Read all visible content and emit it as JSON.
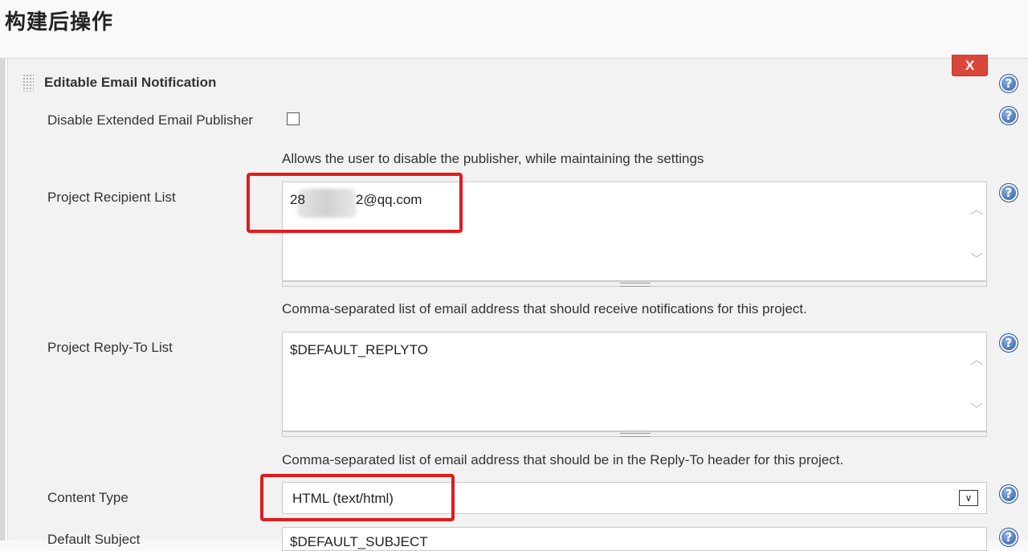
{
  "section": {
    "title": "构建后操作"
  },
  "panel": {
    "title": "Editable Email Notification",
    "delete_label": "X"
  },
  "help_label": "?",
  "disable_publisher": {
    "label": "Disable Extended Email Publisher",
    "checked": false,
    "description": "Allows the user to disable the publisher, while maintaining the settings"
  },
  "recipient_list": {
    "label": "Project Recipient List",
    "value_prefix": "28",
    "value_suffix": "2@qq.com",
    "description": "Comma-separated list of email address that should receive notifications for this project."
  },
  "reply_to_list": {
    "label": "Project Reply-To List",
    "value": "$DEFAULT_REPLYTO",
    "description": "Comma-separated list of email address that should be in the Reply-To header for this project."
  },
  "content_type": {
    "label": "Content Type",
    "value": "HTML (text/html)"
  },
  "default_subject": {
    "label": "Default Subject",
    "value": "$DEFAULT_SUBJECT"
  },
  "colors": {
    "highlight": "#e21b1b",
    "delete": "#d9473a",
    "help": "#3f6db5"
  }
}
